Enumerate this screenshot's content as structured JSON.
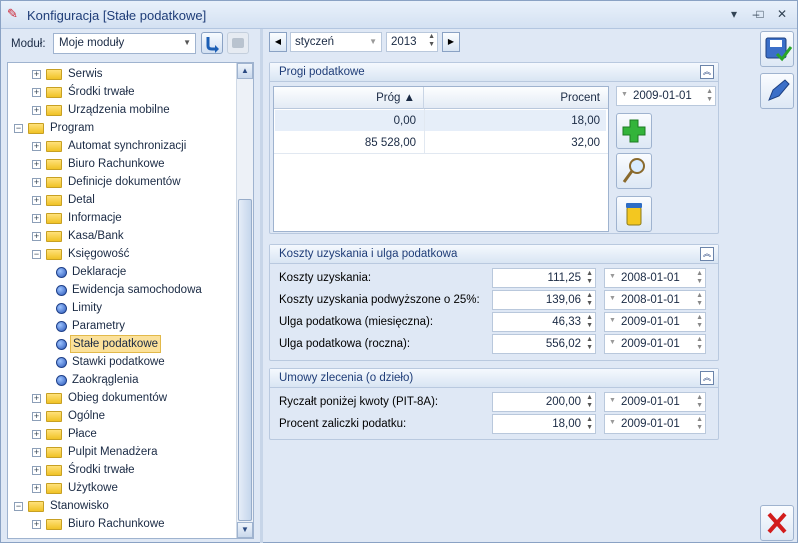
{
  "window": {
    "title": "Konfiguracja [Stałe podatkowe]"
  },
  "module": {
    "label": "Moduł:",
    "value": "Moje moduły"
  },
  "tree": {
    "items": [
      {
        "label": "Serwis",
        "level": 1,
        "type": "folder"
      },
      {
        "label": "Środki trwałe",
        "level": 1,
        "type": "folder"
      },
      {
        "label": "Urządzenia mobilne",
        "level": 1,
        "type": "folder"
      },
      {
        "label": "Program",
        "level": 0,
        "type": "folder"
      },
      {
        "label": "Automat synchronizacji",
        "level": 1,
        "type": "folder"
      },
      {
        "label": "Biuro Rachunkowe",
        "level": 1,
        "type": "folder"
      },
      {
        "label": "Definicje dokumentów",
        "level": 1,
        "type": "folder"
      },
      {
        "label": "Detal",
        "level": 1,
        "type": "folder"
      },
      {
        "label": "Informacje",
        "level": 1,
        "type": "folder"
      },
      {
        "label": "Kasa/Bank",
        "level": 1,
        "type": "folder"
      },
      {
        "label": "Księgowość",
        "level": 1,
        "type": "folder"
      },
      {
        "label": "Deklaracje",
        "level": 2,
        "type": "leaf"
      },
      {
        "label": "Ewidencja samochodowa",
        "level": 2,
        "type": "leaf"
      },
      {
        "label": "Limity",
        "level": 2,
        "type": "leaf"
      },
      {
        "label": "Parametry",
        "level": 2,
        "type": "leaf"
      },
      {
        "label": "Stałe podatkowe",
        "level": 2,
        "type": "leaf",
        "selected": true
      },
      {
        "label": "Stawki podatkowe",
        "level": 2,
        "type": "leaf"
      },
      {
        "label": "Zaokrąglenia",
        "level": 2,
        "type": "leaf"
      },
      {
        "label": "Obieg dokumentów",
        "level": 1,
        "type": "folder"
      },
      {
        "label": "Ogólne",
        "level": 1,
        "type": "folder"
      },
      {
        "label": "Płace",
        "level": 1,
        "type": "folder"
      },
      {
        "label": "Pulpit Menadżera",
        "level": 1,
        "type": "folder"
      },
      {
        "label": "Środki trwałe",
        "level": 1,
        "type": "folder"
      },
      {
        "label": "Użytkowe",
        "level": 1,
        "type": "folder"
      },
      {
        "label": "Stanowisko",
        "level": 0,
        "type": "folder"
      },
      {
        "label": "Biuro Rachunkowe",
        "level": 1,
        "type": "folder"
      }
    ]
  },
  "period": {
    "month": "styczeń",
    "year": "2013"
  },
  "progi": {
    "title": "Progi podatkowe",
    "col_prog": "Próg ▲",
    "col_procent": "Procent",
    "rows": [
      {
        "prog": "0,00",
        "procent": "18,00"
      },
      {
        "prog": "85 528,00",
        "procent": "32,00"
      }
    ],
    "date": "2009-01-01"
  },
  "koszty": {
    "title": "Koszty uzyskania i ulga podatkowa",
    "rows": [
      {
        "label": "Koszty uzyskania:",
        "value": "111,25",
        "date": "2008-01-01"
      },
      {
        "label": "Koszty uzyskania podwyższone o 25%:",
        "value": "139,06",
        "date": "2008-01-01"
      },
      {
        "label": "Ulga podatkowa (miesięczna):",
        "value": "46,33",
        "date": "2009-01-01"
      },
      {
        "label": "Ulga podatkowa (roczna):",
        "value": "556,02",
        "date": "2009-01-01"
      }
    ]
  },
  "umowy": {
    "title": "Umowy zlecenia (o dzieło)",
    "rows": [
      {
        "label": "Ryczałt poniżej kwoty (PIT-8A):",
        "value": "200,00",
        "date": "2009-01-01"
      },
      {
        "label": "Procent zaliczki podatku:",
        "value": "18,00",
        "date": "2009-01-01"
      }
    ]
  }
}
